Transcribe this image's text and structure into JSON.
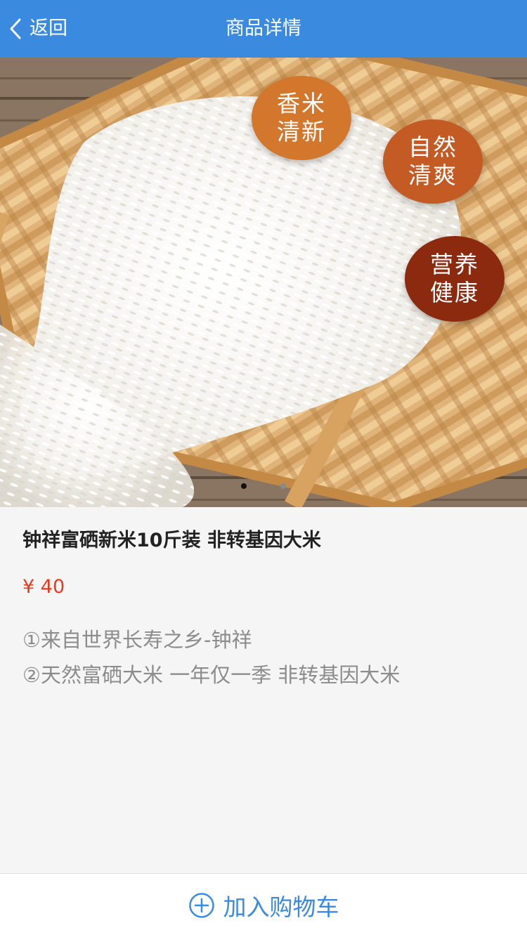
{
  "navbar": {
    "back_label": "返回",
    "title": "商品详情"
  },
  "carousel": {
    "badges": [
      {
        "line1": "香米",
        "line2": "清新",
        "color": "#d2772c"
      },
      {
        "line1": "自然",
        "line2": "清爽",
        "color": "#c45a24"
      },
      {
        "line1": "营养",
        "line2": "健康",
        "color": "#8c2a10"
      }
    ],
    "page_count": 2,
    "active_page": 1
  },
  "product": {
    "title": "钟祥富硒新米10斤装 非转基因大米",
    "price": "¥ 40",
    "features": [
      "①来自世界长寿之乡-钟祥",
      "②天然富硒大米 一年仅一季 非转基因大米"
    ]
  },
  "bottom": {
    "add_to_cart_label": "加入购物车",
    "icon": "plus-circle-icon"
  },
  "colors": {
    "accent": "#3a8be0",
    "price": "#e83a1e",
    "desc": "#8c8c8c"
  }
}
